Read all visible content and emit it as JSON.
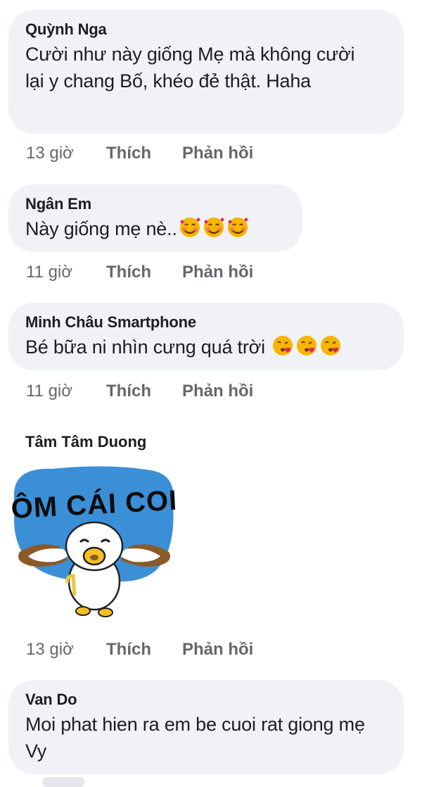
{
  "comments": [
    {
      "author": "Quỳnh Nga",
      "text": "Cười như này giống Mẹ mà không cười lại y chang Bố, khéo đẻ thật. Haha",
      "time": "13 giờ",
      "like": "Thích",
      "reply": "Phản hồi"
    },
    {
      "author": "Ngân Em",
      "text": "Này giống mẹ nè..",
      "emojis": [
        "smiling-face-with-hearts",
        "smiling-face-with-hearts",
        "smiling-face-with-hearts"
      ],
      "time": "11 giờ",
      "like": "Thích",
      "reply": "Phản hồi"
    },
    {
      "author": "Minh Châu Smartphone",
      "text": "Bé bữa ni nhìn cưng quá trời",
      "emojis": [
        "face-blowing-kiss",
        "face-blowing-kiss",
        "face-blowing-kiss"
      ],
      "time": "11 giờ",
      "like": "Thích",
      "reply": "Phản hồi"
    },
    {
      "author": "Tâm Tâm Duong",
      "sticker_text": "ÔM CÁI COI",
      "sticker_icon": "hugging-duck-sticker",
      "time": "13 giờ",
      "like": "Thích",
      "reply": "Phản hồi"
    },
    {
      "author": "Van Do",
      "text": "Moi phat hien ra em be cuoi rat giong mẹ Vy"
    }
  ],
  "colors": {
    "bubble": "#f0f2f5",
    "text": "#1c1e21",
    "meta": "#65676b",
    "sticker_blue": "#3b8fd6"
  }
}
